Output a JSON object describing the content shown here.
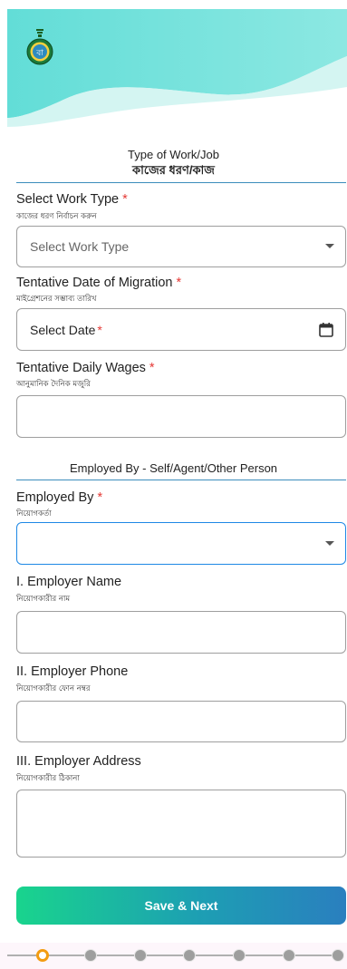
{
  "header": {
    "logo_icon": "west-bengal-govt-emblem-icon"
  },
  "work_section": {
    "title_en": "Type of Work/Job",
    "title_bn": "কাজের ধরণ/কাজ"
  },
  "work_type": {
    "label": "Select Work Type",
    "required_mark": "*",
    "sub": "কাজের ধরণ নির্বাচন করুন",
    "placeholder": "Select Work Type"
  },
  "migration_date": {
    "label": "Tentative Date of Migration",
    "required_mark": "*",
    "sub": "মাইগ্রেশনের সম্ভাব্য তারিখ",
    "placeholder": "Select Date",
    "placeholder_required": "*"
  },
  "daily_wages": {
    "label": "Tentative Daily Wages",
    "required_mark": "*",
    "sub": "আনুমানিক দৈনিক মজুরি",
    "value": ""
  },
  "employer_section": {
    "title": "Employed By - Self/Agent/Other Person"
  },
  "employed_by": {
    "label": "Employed By",
    "required_mark": "*",
    "sub": "নিয়োগকর্তা",
    "value": ""
  },
  "employer_name": {
    "label": "I. Employer Name",
    "sub": "নিয়োগকারীর নাম",
    "value": ""
  },
  "employer_phone": {
    "label": "II. Employer Phone",
    "sub": "নিয়োগকারীর ফোন নম্বর",
    "value": ""
  },
  "employer_address": {
    "label": "III. Employer Address",
    "sub": "নিয়োগকারীর ঠিকানা",
    "value": ""
  },
  "actions": {
    "save_next": "Save & Next"
  },
  "stepper": {
    "total_steps": 7,
    "current_step": 1
  },
  "colors": {
    "accent_blue": "#1e88e5",
    "required_red": "#e53935",
    "header_teal": "#4fd6cf",
    "button_gradient_start": "#19d48d",
    "button_gradient_end": "#2a7fbf",
    "step_current": "#f39c12"
  }
}
